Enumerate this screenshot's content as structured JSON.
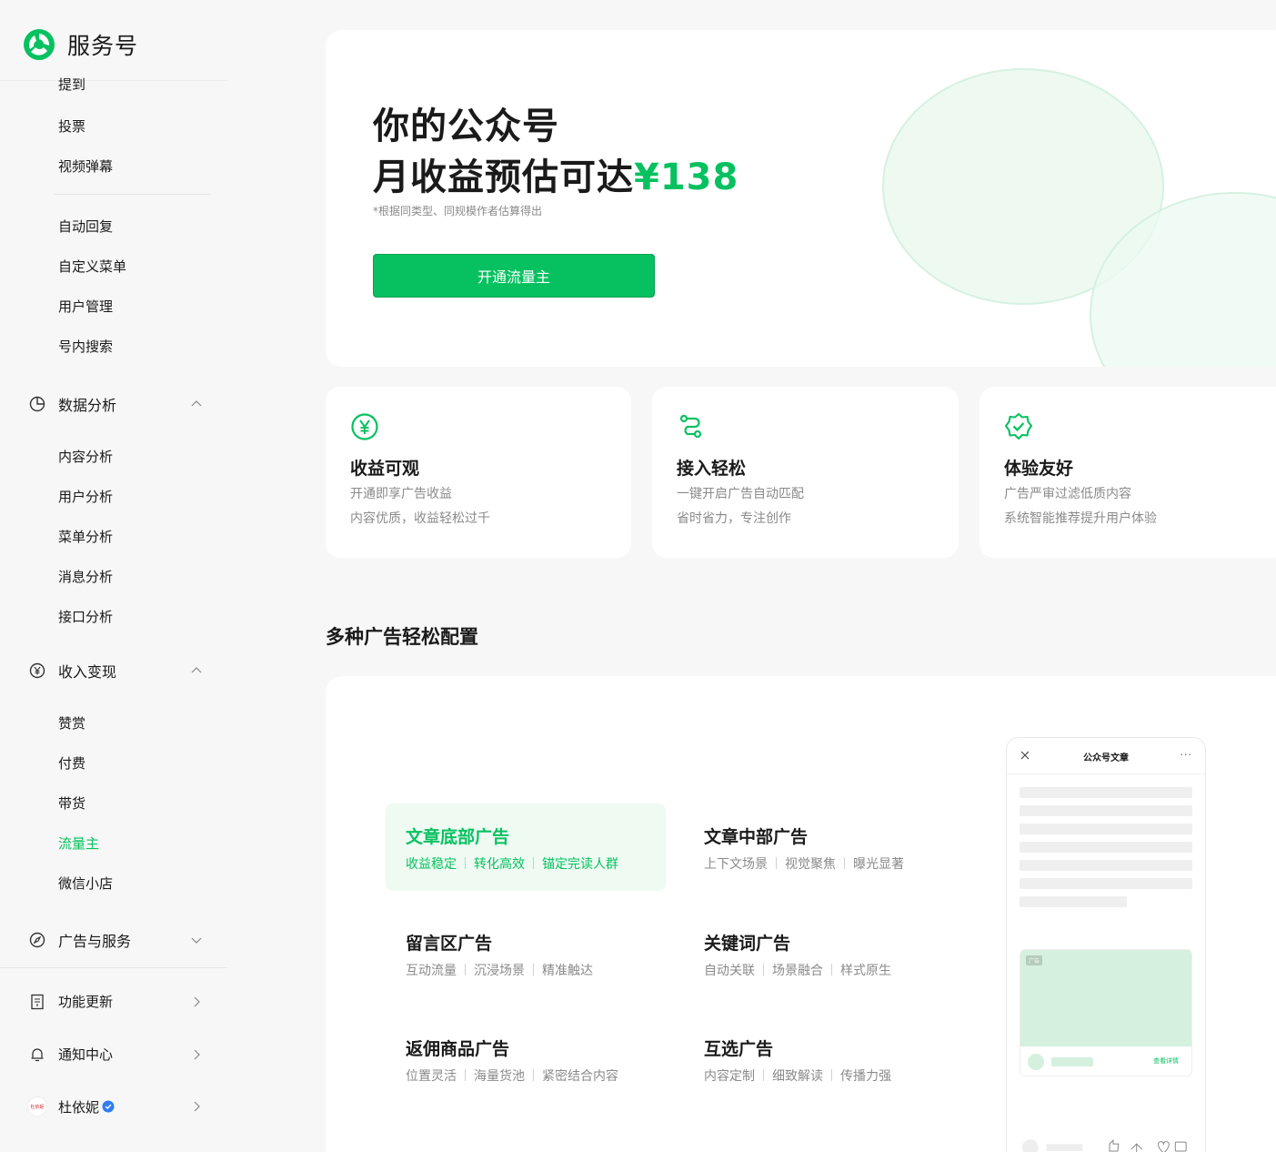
{
  "brand": {
    "name": "服务号"
  },
  "sidebar": {
    "top_items": [
      "提到",
      "投票",
      "视频弹幕"
    ],
    "basic_items": [
      "自动回复",
      "自定义菜单",
      "用户管理",
      "号内搜索"
    ],
    "data_analysis": {
      "label": "数据分析",
      "items": [
        "内容分析",
        "用户分析",
        "菜单分析",
        "消息分析",
        "接口分析"
      ]
    },
    "income": {
      "label": "收入变现",
      "items": [
        "赞赏",
        "付费",
        "带货",
        "流量主",
        "微信小店"
      ],
      "active": "流量主"
    },
    "ads_services": {
      "label": "广告与服务"
    },
    "updates": {
      "label": "功能更新"
    },
    "notifications": {
      "label": "通知中心"
    },
    "user": {
      "name": "杜依妮",
      "avatar_text": "杜依妮"
    }
  },
  "hero": {
    "line1": "你的公众号",
    "line2": "月收益预估可达",
    "amount": "¥138",
    "note": "*根据同类型、同规模作者估算得出",
    "button": "开通流量主"
  },
  "features": [
    {
      "icon": "yuan-circle-icon",
      "title": "收益可观",
      "lines": [
        "开通即享广告收益",
        "内容优质，收益轻松过千"
      ]
    },
    {
      "icon": "route-icon",
      "title": "接入轻松",
      "lines": [
        "一键开启广告自动匹配",
        "省时省力，专注创作"
      ]
    },
    {
      "icon": "shield-check-icon",
      "title": "体验友好",
      "lines": [
        "广告严审过滤低质内容",
        "系统智能推荐提升用户体验"
      ]
    }
  ],
  "section_title": "多种广告轻松配置",
  "ad_types": [
    {
      "title": "文章底部广告",
      "tags": [
        "收益稳定",
        "转化高效",
        "锚定完读人群"
      ]
    },
    {
      "title": "文章中部广告",
      "tags": [
        "上下文场景",
        "视觉聚焦",
        "曝光显著"
      ]
    },
    {
      "title": "留言区广告",
      "tags": [
        "互动流量",
        "沉浸场景",
        "精准触达"
      ]
    },
    {
      "title": "关键词广告",
      "tags": [
        "自动关联",
        "场景融合",
        "样式原生"
      ]
    },
    {
      "title": "返佣商品广告",
      "tags": [
        "位置灵活",
        "海量货池",
        "紧密结合内容"
      ]
    },
    {
      "title": "互选广告",
      "tags": [
        "内容定制",
        "细致解读",
        "传播力强"
      ]
    }
  ],
  "phone_preview": {
    "title": "公众号文章",
    "menu": "···",
    "ad_badge": "广告",
    "ad_link": "查看详情"
  },
  "colors": {
    "accent": "#07c160",
    "text": "#1a1a1a",
    "muted": "#8a8a8a",
    "bg": "#f7f7f7"
  }
}
